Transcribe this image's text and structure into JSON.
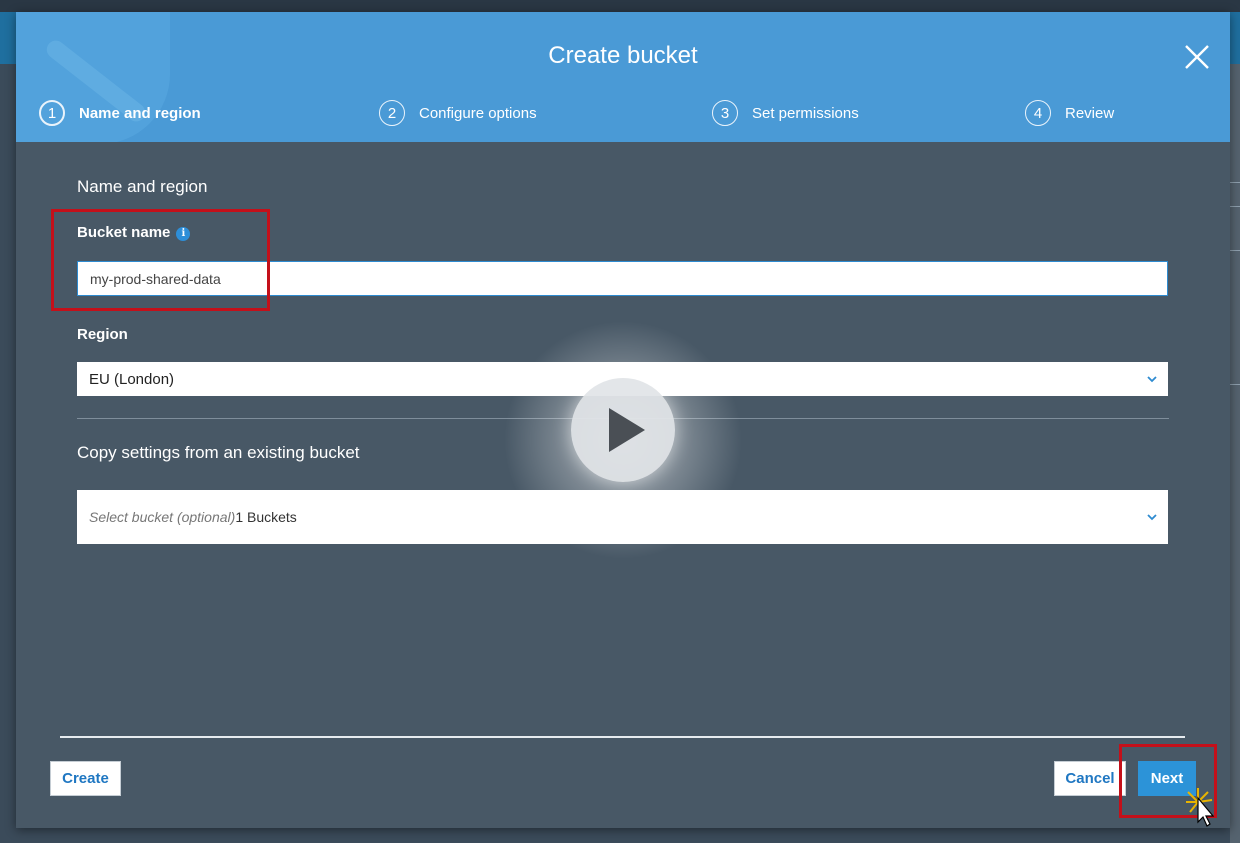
{
  "modal": {
    "title": "Create bucket",
    "steps": [
      {
        "num": "1",
        "label": "Name and region",
        "active": true
      },
      {
        "num": "2",
        "label": "Configure options",
        "active": false
      },
      {
        "num": "3",
        "label": "Set permissions",
        "active": false
      },
      {
        "num": "4",
        "label": "Review",
        "active": false
      }
    ]
  },
  "form": {
    "section_title": "Name and region",
    "bucket_name_label": "Bucket name",
    "bucket_name_value": "my-prod-shared-data",
    "region_label": "Region",
    "region_value": "EU (London)",
    "copy_settings_title": "Copy settings from an existing bucket",
    "select_bucket_placeholder": "Select bucket (optional)",
    "select_bucket_count": "1 Buckets"
  },
  "footer": {
    "create_label": "Create",
    "cancel_label": "Cancel",
    "next_label": "Next"
  },
  "colors": {
    "header_blue": "#4a9ad6",
    "body_slate": "#485866",
    "primary_button": "#2c93d8",
    "highlight_red": "#c4101a"
  },
  "icons": [
    "close-icon",
    "info-icon",
    "chevron-down-icon",
    "play-icon",
    "mouse-cursor-icon"
  ]
}
